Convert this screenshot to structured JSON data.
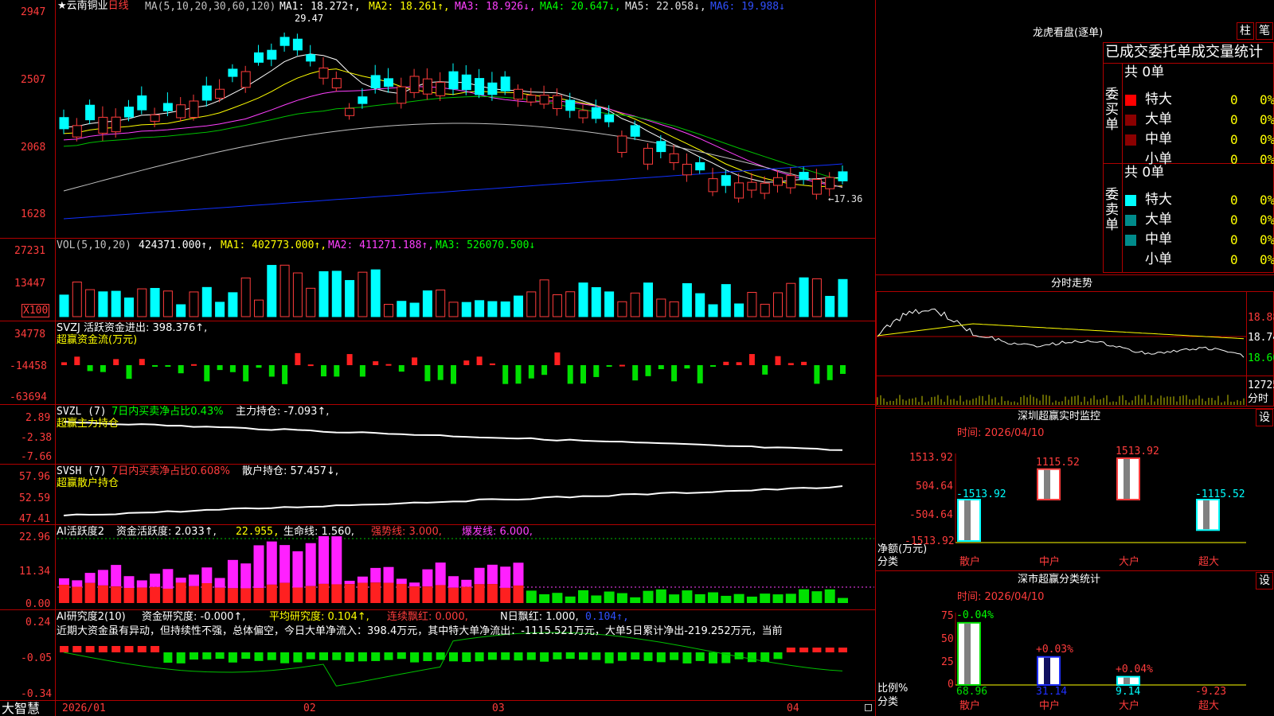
{
  "main": {
    "stock_name": "云南铜业",
    "period": "日线",
    "ma_label": "MA(5,10,20,30,60,120)",
    "ma1": "MA1: 18.272↑,",
    "ma2": "MA2: 18.261↑,",
    "ma3": "MA3: 18.926↓,",
    "ma4": "MA4: 20.647↓,",
    "ma5": "MA5: 22.058↓,",
    "ma6": "MA6: 19.988↓",
    "high_mark": "29.47",
    "low_mark": "←17.36",
    "y_ticks": [
      "2947",
      "2507",
      "2068",
      "1628"
    ]
  },
  "vol": {
    "label": "VOL(5,10,20)",
    "value": "424371.000↑,",
    "ma1": "MA1: 402773.000↑,",
    "ma2": "MA2: 411271.188↑,",
    "ma3": "MA3: 526070.500↓",
    "y_ticks": [
      "27231",
      "13447"
    ],
    "unit": "X100"
  },
  "svzj": {
    "label": "SVZJ  活跃资金进出: 398.376↑,",
    "sub": "超赢资金流(万元)",
    "y_ticks": [
      "34778",
      "-14458",
      "-63694"
    ]
  },
  "svzl": {
    "label": "SVZL (7)",
    "ratio": "7日内买卖净占比0.43%",
    "value": "主力持仓: -7.093↑,",
    "sub": "超赢主力持仓",
    "y_ticks": [
      "2.89",
      "-2.38",
      "-7.66"
    ]
  },
  "svsh": {
    "label": "SVSH (7)",
    "ratio": "7日内买卖净占比0.608%",
    "value": "散户持仓: 57.457↓,",
    "sub": "超赢散户持仓",
    "y_ticks": [
      "57.96",
      "52.59",
      "47.41"
    ]
  },
  "ai1": {
    "label": "AI活跃度2",
    "a": "资金活跃度: 2.033↑,",
    "b": "22.955,",
    "c": "生命线: 1.560,",
    "d": "强势线: 3.000,",
    "e": "爆发线: 6.000,",
    "y_ticks": [
      "22.96",
      "11.34",
      "0.00"
    ]
  },
  "ai2": {
    "label": "AI研究度2(10)",
    "a": "资金研究度: -0.000↑,",
    "b": "平均研究度: 0.104↑,",
    "c": "连续飘红: 0.000,",
    "d": "N日飘红: 1.000,",
    "e": "0.104↑,",
    "comment": "近期大资金虽有异动，但持续性不强，总体偏空，今日大单净流入：398.4万元，其中特大单净流出：-1115.521万元，大单5日累计净出-219.252万元，当前",
    "y_ticks": [
      "0.24",
      "-0.05",
      "-0.34"
    ]
  },
  "xaxis": {
    "brand": "大智慧",
    "labels": [
      "2026/01",
      "02",
      "03",
      "04"
    ]
  },
  "lhb": {
    "title": "龙虎看盘(逐单)",
    "btn1": "柱",
    "btn2": "笔",
    "header": "已成交委托单成交量统计",
    "buy_group": "委买单",
    "sell_group": "委卖单",
    "buy_total": "共 0单",
    "sell_total": "共 0单",
    "rows": [
      {
        "name": "特大",
        "val": "0",
        "pct": "0%"
      },
      {
        "name": "大单",
        "val": "0",
        "pct": "0%"
      },
      {
        "name": "中单",
        "val": "0",
        "pct": "0%"
      },
      {
        "name": "小单",
        "val": "0",
        "pct": "0%"
      }
    ],
    "colors": {
      "buy": [
        "#ff0000",
        "#8b0000",
        "#8b0000"
      ],
      "sell": [
        "#00ffff",
        "#008b8b",
        "#008b8b"
      ]
    }
  },
  "fenshi": {
    "title": "分时走势",
    "y_ticks": [
      "18.88",
      "18.74",
      "18.60"
    ],
    "vol_tick": "12725",
    "footer": "分时"
  },
  "szmon": {
    "title": "深圳超赢实时监控",
    "btn": "设",
    "time": "时间: 2026/04/10",
    "y_ticks": [
      "1513.92",
      "504.64",
      "-504.64",
      "-1513.92"
    ],
    "unit": "净额(万元)",
    "cat_label": "分类",
    "bars": [
      {
        "cat": "散户",
        "value": -1513.92,
        "label": "-1513.92"
      },
      {
        "cat": "中户",
        "value": 1115.52,
        "label": "1115.52"
      },
      {
        "cat": "大户",
        "value": 1513.92,
        "label": "1513.92"
      },
      {
        "cat": "超大",
        "value": -1115.52,
        "label": "-1115.52"
      }
    ]
  },
  "szstat": {
    "title": "深市超赢分类统计",
    "btn": "设",
    "time": "时间: 2026/04/10",
    "y_ticks": [
      "75",
      "50",
      "25",
      "0"
    ],
    "unit": "比例%",
    "cat_label": "分类",
    "bars": [
      {
        "cat": "散户",
        "value": 68.96,
        "label": "68.96",
        "delta": "-0.04%"
      },
      {
        "cat": "中户",
        "value": 31.14,
        "label": "31.14",
        "delta": "+0.03%"
      },
      {
        "cat": "大户",
        "value": 9.14,
        "label": "9.14",
        "delta": "+0.04%"
      },
      {
        "cat": "超大",
        "value": -9.23,
        "label": "-9.23",
        "delta": ""
      }
    ]
  }
}
